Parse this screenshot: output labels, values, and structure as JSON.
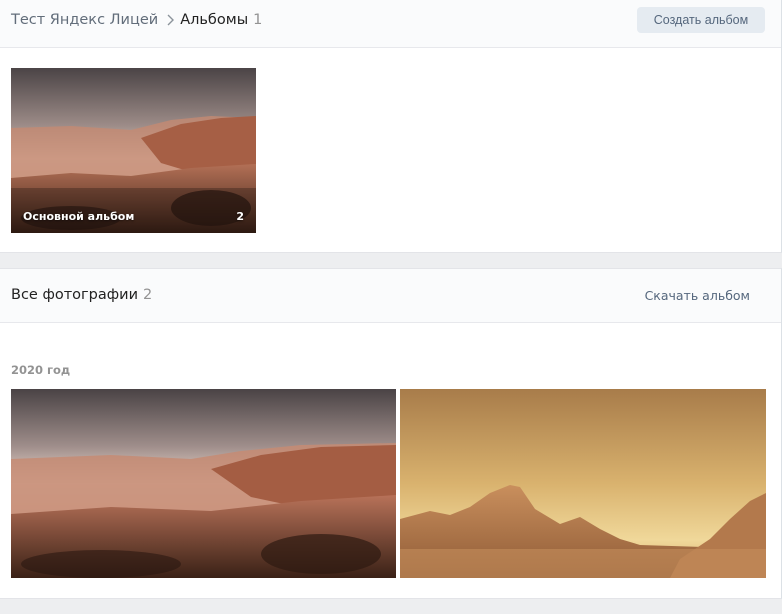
{
  "header": {
    "breadcrumb_link": "Тест Яндекс Лицей",
    "current": "Альбомы",
    "count": "1",
    "create_button": "Создать альбом"
  },
  "albums": [
    {
      "title": "Основной альбом",
      "count": "2"
    }
  ],
  "all_photos": {
    "title": "Все фотографии",
    "count": "2",
    "download_button": "Скачать альбом",
    "year_label": "2020 год"
  },
  "icons": {
    "breadcrumb_separator": "chevron-right-icon"
  },
  "colors": {
    "accent_text": "#55677d",
    "button_bg": "#e5ebf1",
    "page_bg": "#edeef0"
  }
}
